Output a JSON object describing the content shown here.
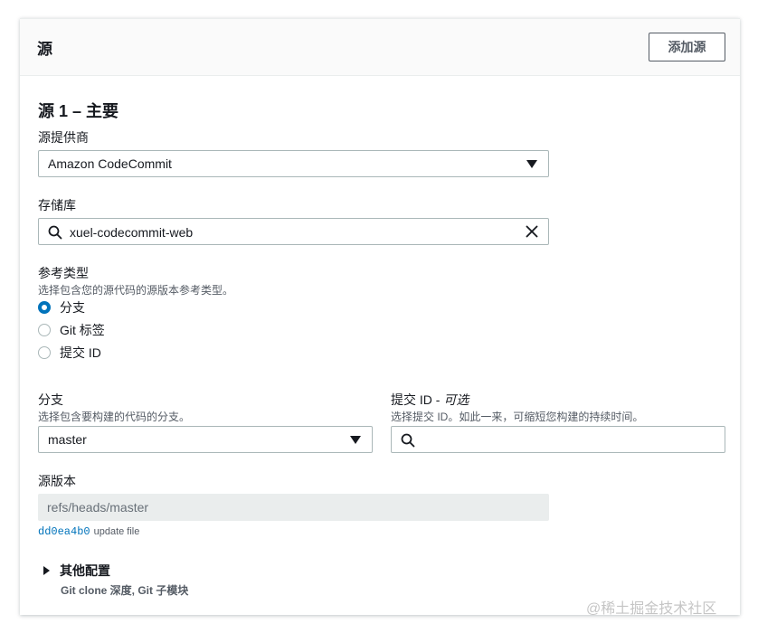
{
  "header": {
    "title": "源",
    "add_source_label": "添加源"
  },
  "source": {
    "title": "源 1 – 主要",
    "provider": {
      "label": "源提供商",
      "value": "Amazon CodeCommit"
    },
    "repository": {
      "label": "存储库",
      "value": "xuel-codecommit-web"
    },
    "reference_type": {
      "label": "参考类型",
      "description": "选择包含您的源代码的源版本参考类型。",
      "options": [
        {
          "label": "分支",
          "selected": true
        },
        {
          "label": "Git 标签",
          "selected": false
        },
        {
          "label": "提交 ID",
          "selected": false
        }
      ]
    },
    "branch": {
      "label": "分支",
      "description": "选择包含要构建的代码的分支。",
      "value": "master"
    },
    "commit_id": {
      "label": "提交 ID - ",
      "optional": "可选",
      "description": "选择提交 ID。如此一来，可缩短您构建的持续时间。",
      "value": ""
    },
    "source_version": {
      "label": "源版本",
      "value": "refs/heads/master",
      "commit_hash": "dd0ea4b0",
      "commit_message": "update file"
    },
    "additional_config": {
      "label": "其他配置",
      "description": "Git clone 深度, Git 子模块"
    }
  },
  "watermark": "@稀土掘金技术社区",
  "colors": {
    "accent": "#0073bb",
    "border": "#aab7b8",
    "header_bg": "#fafafa"
  }
}
